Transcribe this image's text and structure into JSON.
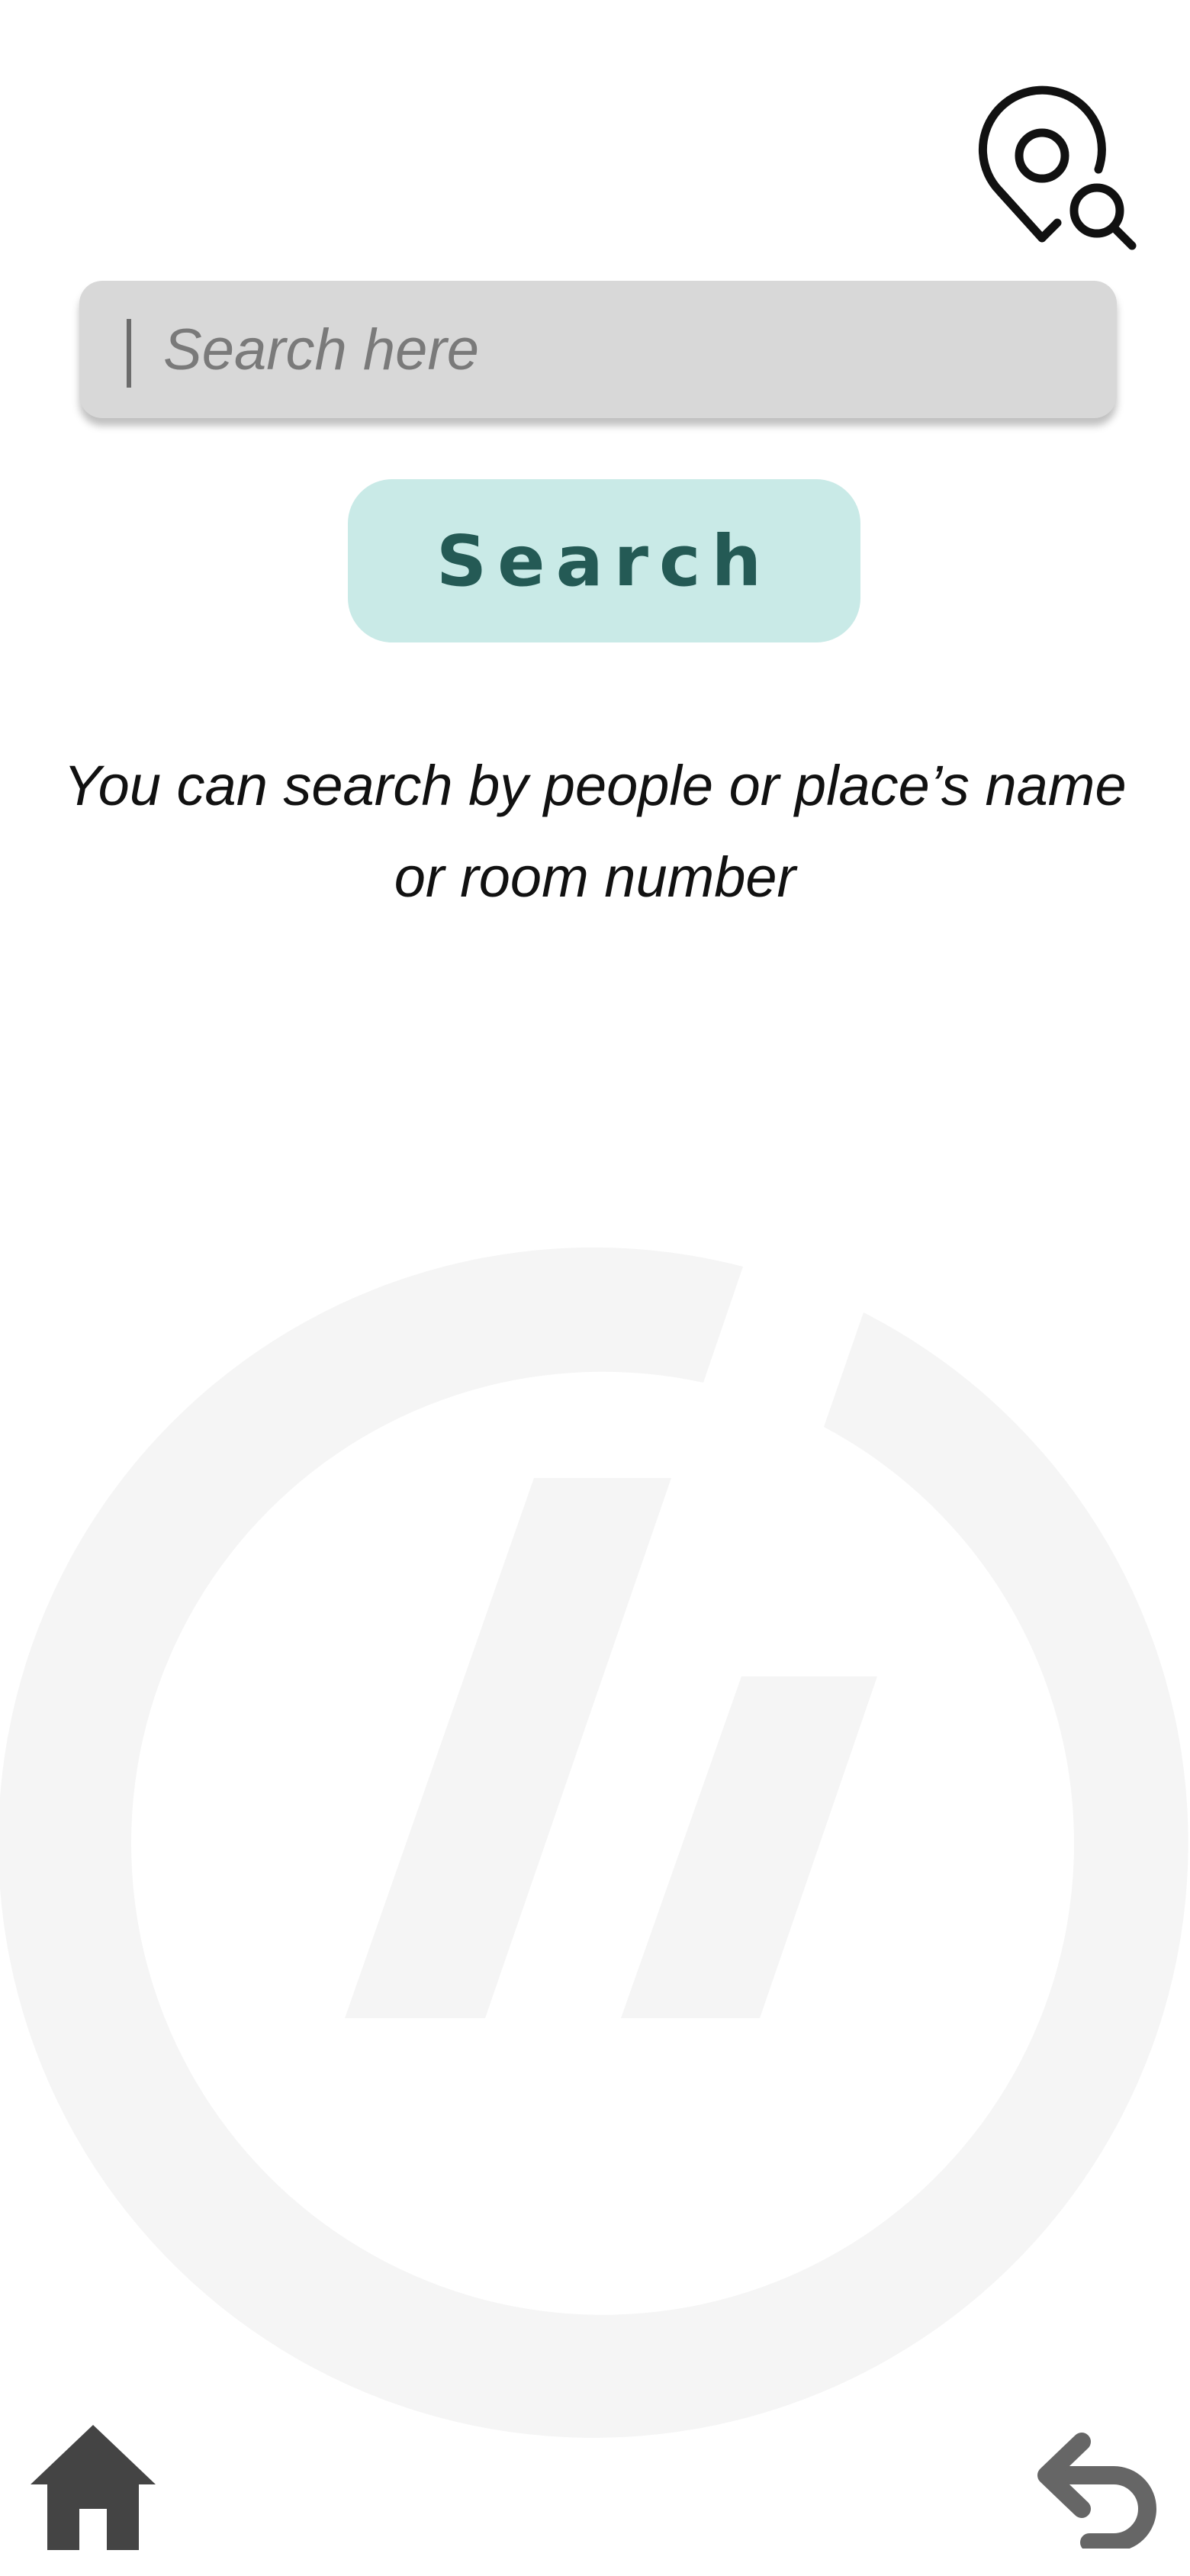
{
  "header": {
    "map_icon": "map-pin-search-icon"
  },
  "search": {
    "placeholder": "Search here",
    "value": "",
    "button_label": "Search"
  },
  "hint": {
    "line1": "You can search by people or place’s name",
    "line2": "or room number"
  },
  "footer": {
    "home_icon": "home-icon",
    "back_icon": "back-arrow-icon"
  },
  "colors": {
    "search_field_bg": "#d8d8d8",
    "button_bg": "#c9eae7",
    "button_text": "#245a55",
    "watermark": "#f5f5f5",
    "icon_dark": "#444444",
    "icon_back": "#666666"
  }
}
